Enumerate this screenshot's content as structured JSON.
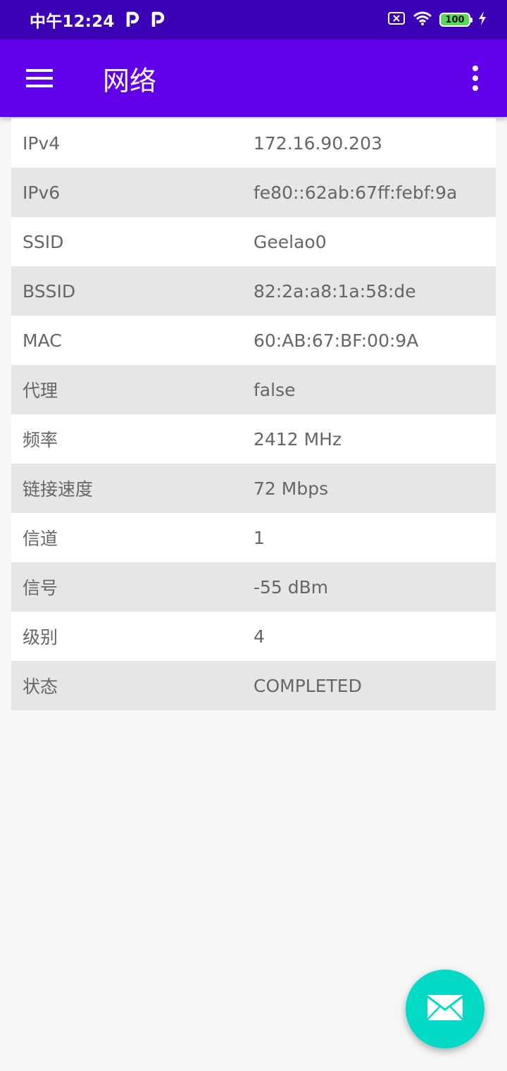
{
  "status_bar": {
    "time": "中午12:24",
    "battery_level": "100",
    "icons": [
      "p-icon",
      "p-icon",
      "screen-off-icon",
      "wifi-icon",
      "battery-icon",
      "charging-icon"
    ]
  },
  "app_bar": {
    "title": "网络",
    "color": "#6200ea"
  },
  "network_info": {
    "rows": [
      {
        "key": "IPv4",
        "value": "172.16.90.203"
      },
      {
        "key": "IPv6",
        "value": "fe80::62ab:67ff:febf:9a"
      },
      {
        "key": "SSID",
        "value": "Geelao0"
      },
      {
        "key": "BSSID",
        "value": "82:2a:a8:1a:58:de"
      },
      {
        "key": "MAC",
        "value": "60:AB:67:BF:00:9A"
      },
      {
        "key": "代理",
        "value": "false"
      },
      {
        "key": "频率",
        "value": "2412 MHz"
      },
      {
        "key": "链接速度",
        "value": "72 Mbps"
      },
      {
        "key": "信道",
        "value": "1"
      },
      {
        "key": "信号",
        "value": "-55 dBm"
      },
      {
        "key": "级别",
        "value": "4"
      },
      {
        "key": "状态",
        "value": "COMPLETED"
      }
    ]
  },
  "fab": {
    "icon": "email-icon",
    "color": "#03dac5"
  }
}
